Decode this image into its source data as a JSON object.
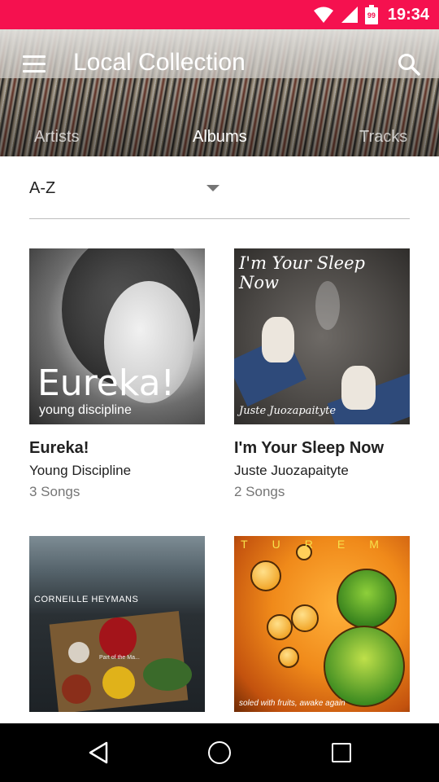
{
  "status_bar": {
    "time": "19:34",
    "battery_level": "99",
    "bg_color": "#f5114f"
  },
  "header": {
    "title": "Local Collection",
    "tabs": [
      {
        "label": "Artists",
        "active": false
      },
      {
        "label": "Albums",
        "active": true
      },
      {
        "label": "Tracks",
        "active": false
      }
    ]
  },
  "sort": {
    "selected": "A-Z"
  },
  "albums": [
    {
      "title": "Eureka!",
      "artist": "Young Discipline",
      "songs": "3 Songs",
      "cover_text": "Eureka!",
      "cover_subtext": "young discipline"
    },
    {
      "title": "I'm Your Sleep Now",
      "artist": "Juste Juozapaityte",
      "songs": "2 Songs",
      "cover_text": "I'm Your Sleep Now",
      "cover_subtext": "Juste Juozapaityte"
    },
    {
      "cover_text": "CORNEILLE HEYMANS",
      "cover_subtext": "Part of the Ma..."
    },
    {
      "cover_text": "TUREM",
      "cover_subtext": "soled with fruits, awake again"
    }
  ]
}
